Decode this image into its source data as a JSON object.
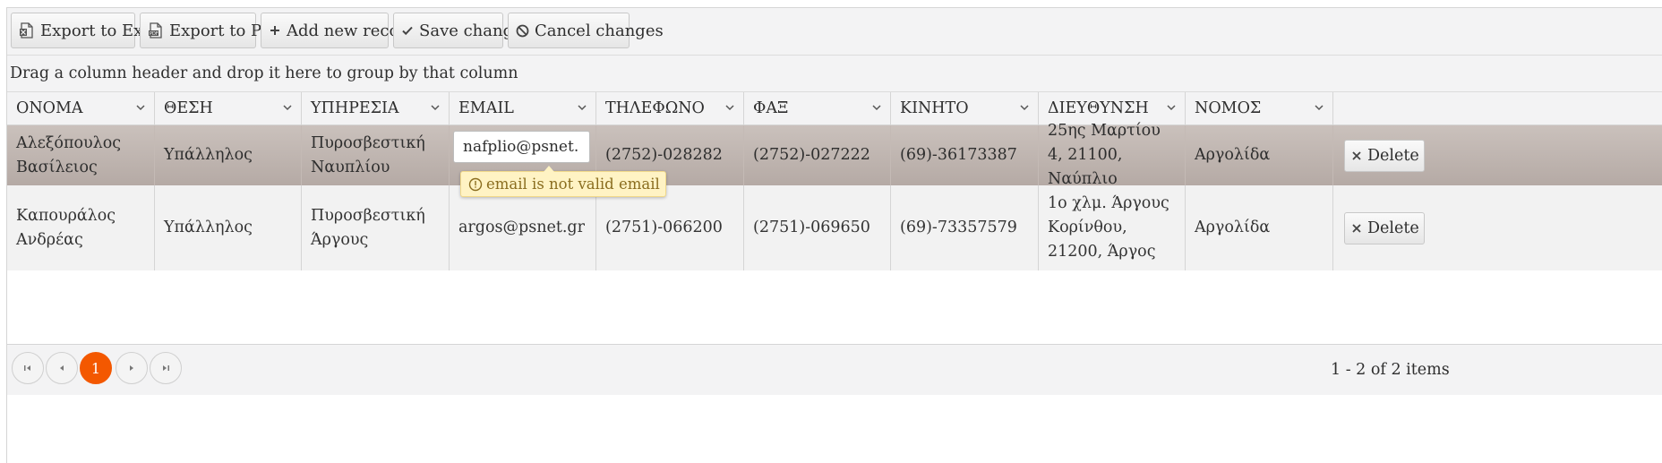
{
  "toolbar": {
    "export_excel": "Export to Excel",
    "export_pdf": "Export to PDF",
    "add_record": "Add new record",
    "save_changes": "Save changes",
    "cancel_changes": "Cancel changes"
  },
  "group_bar": {
    "hint": "Drag a column header and drop it here to group by that column"
  },
  "columns": [
    "ΟΝΟΜΑ",
    "ΘΕΣΗ",
    "ΥΠΗΡΕΣΙΑ",
    "EMAIL",
    "ΤΗΛΕΦΩΝΟ",
    "ΦΑΞ",
    "ΚΙΝΗΤΟ",
    "ΔΙΕΥΘΥΝΣΗ",
    "ΝΟΜΟΣ"
  ],
  "rows": [
    {
      "name": "Αλεξόπουλος Βασίλειος",
      "position": "Υπάλληλος",
      "service": "Πυροσβεστική Ναυπλίου",
      "email": "nafplio@psnet.",
      "phone": "(2752)-028282",
      "fax": "(2752)-027222",
      "mobile": "(69)-36173387",
      "address": "25ης Μαρτίου 4, 21100, Ναύπλιο",
      "prefecture": "Αργολίδα",
      "delete": "Delete"
    },
    {
      "name": "Καπουράλος Ανδρέας",
      "position": "Υπάλληλος",
      "service": "Πυροσβεστική Άργους",
      "email": "argos@psnet.gr",
      "phone": "(2751)-066200",
      "fax": "(2751)-069650",
      "mobile": "(69)-73357579",
      "address": "1ο χλμ. Άργους Κορίνθου, 21200, Άργος",
      "prefecture": "Αργολίδα",
      "delete": "Delete"
    }
  ],
  "validation": {
    "message": "email is not valid email"
  },
  "pager": {
    "current_page": "1",
    "info": "1 - 2 of 2 items"
  },
  "colors": {
    "accent": "#f35800",
    "selected_row": "#bdb3ae",
    "tooltip_bg": "#fff3c4",
    "toolbar_bg": "#f3f3f4"
  },
  "icons": [
    "excel-icon",
    "pdf-icon",
    "plus-icon",
    "check-icon",
    "cancel-icon",
    "chevron-down-icon",
    "close-icon",
    "warning-icon",
    "first-page-icon",
    "prev-page-icon",
    "next-page-icon",
    "last-page-icon"
  ]
}
